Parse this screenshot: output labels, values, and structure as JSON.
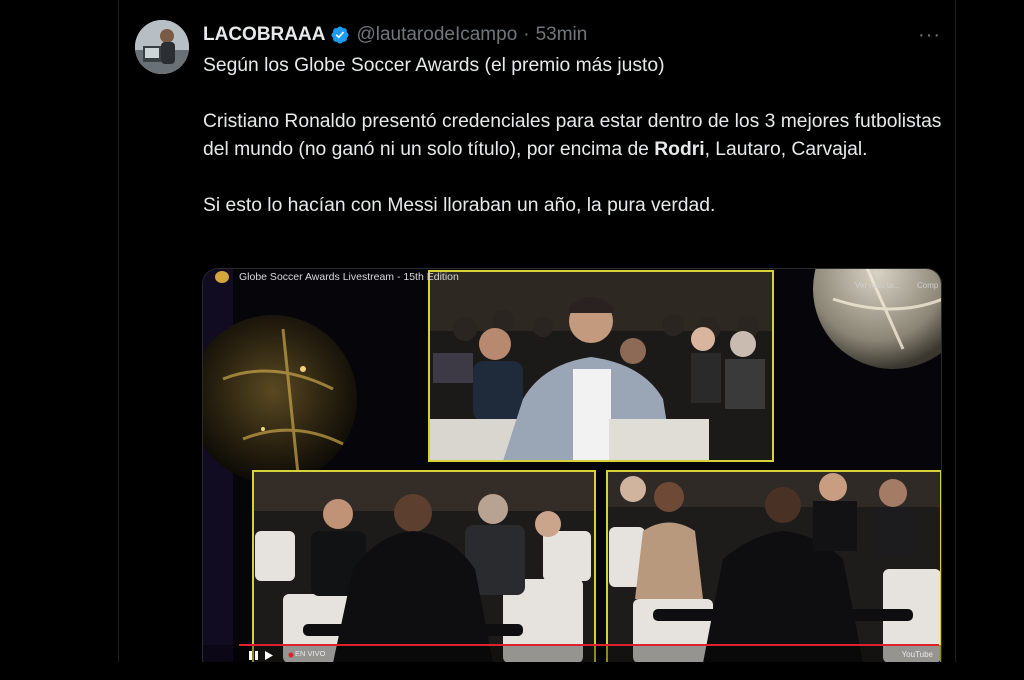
{
  "tweet": {
    "author_name": "LACOBRAAA",
    "handle": "@lautarodeIcampo",
    "separator": "·",
    "time": "53min",
    "more_label": "···",
    "text": {
      "line1": "Según los Globe Soccer Awards (el premio más justo)",
      "para2_part1": "Cristiano Ronaldo presentó credenciales para estar dentro de los 3 mejores futbolistas del mundo (no ganó ni un solo título), por encima de ",
      "para2_bold": "Rodri",
      "para2_part2": ", Lautaro, Carvajal.",
      "para3": "Si esto lo hacían con Messi lloraban un año, la pura verdad."
    }
  },
  "media": {
    "video_title": "Globe Soccer Awards Livestream - 15th Edition",
    "ver_mas": "Ver más ta...",
    "compartir": "Comp",
    "live_label": "EN VIVO",
    "platform_label": "YouTube",
    "highlight_color": "#d8d23a",
    "progress_color": "#e0202a"
  },
  "colors": {
    "background": "#000000",
    "text": "#e7e9ea",
    "muted": "#71767b",
    "verified": "#1d9bf0"
  }
}
